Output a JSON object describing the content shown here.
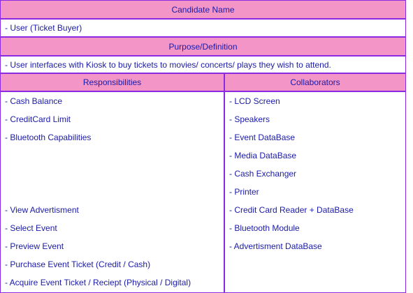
{
  "candidate": {
    "header": "Candidate Name",
    "value": "- User (Ticket Buyer)"
  },
  "purpose": {
    "header": "Purpose/Definition",
    "value": "- User interfaces with Kiosk to buy tickets to movies/ concerts/ plays they wish to attend."
  },
  "responsibilities": {
    "header": "Responsibilities",
    "items": [
      "- Cash Balance",
      "- CreditCard Limit",
      "- Bluetooth Capabilities",
      "",
      "",
      "",
      "- View Advertisment",
      "- Select Event",
      "- Preview Event",
      "- Purchase Event Ticket (Credit / Cash)",
      "- Acquire Event Ticket / Reciept (Physical / Digital)"
    ]
  },
  "collaborators": {
    "header": "Collaborators",
    "items": [
      "- LCD Screen",
      "- Speakers",
      "- Event DataBase",
      "- Media DataBase",
      "- Cash Exchanger",
      "- Printer",
      "- Credit Card Reader + DataBase",
      "- Bluetooth Module",
      "- Advertisment DataBase"
    ]
  },
  "colors": {
    "header_bg": "#f395c6",
    "border": "#8a2be2",
    "text": "#1a1aa8"
  }
}
